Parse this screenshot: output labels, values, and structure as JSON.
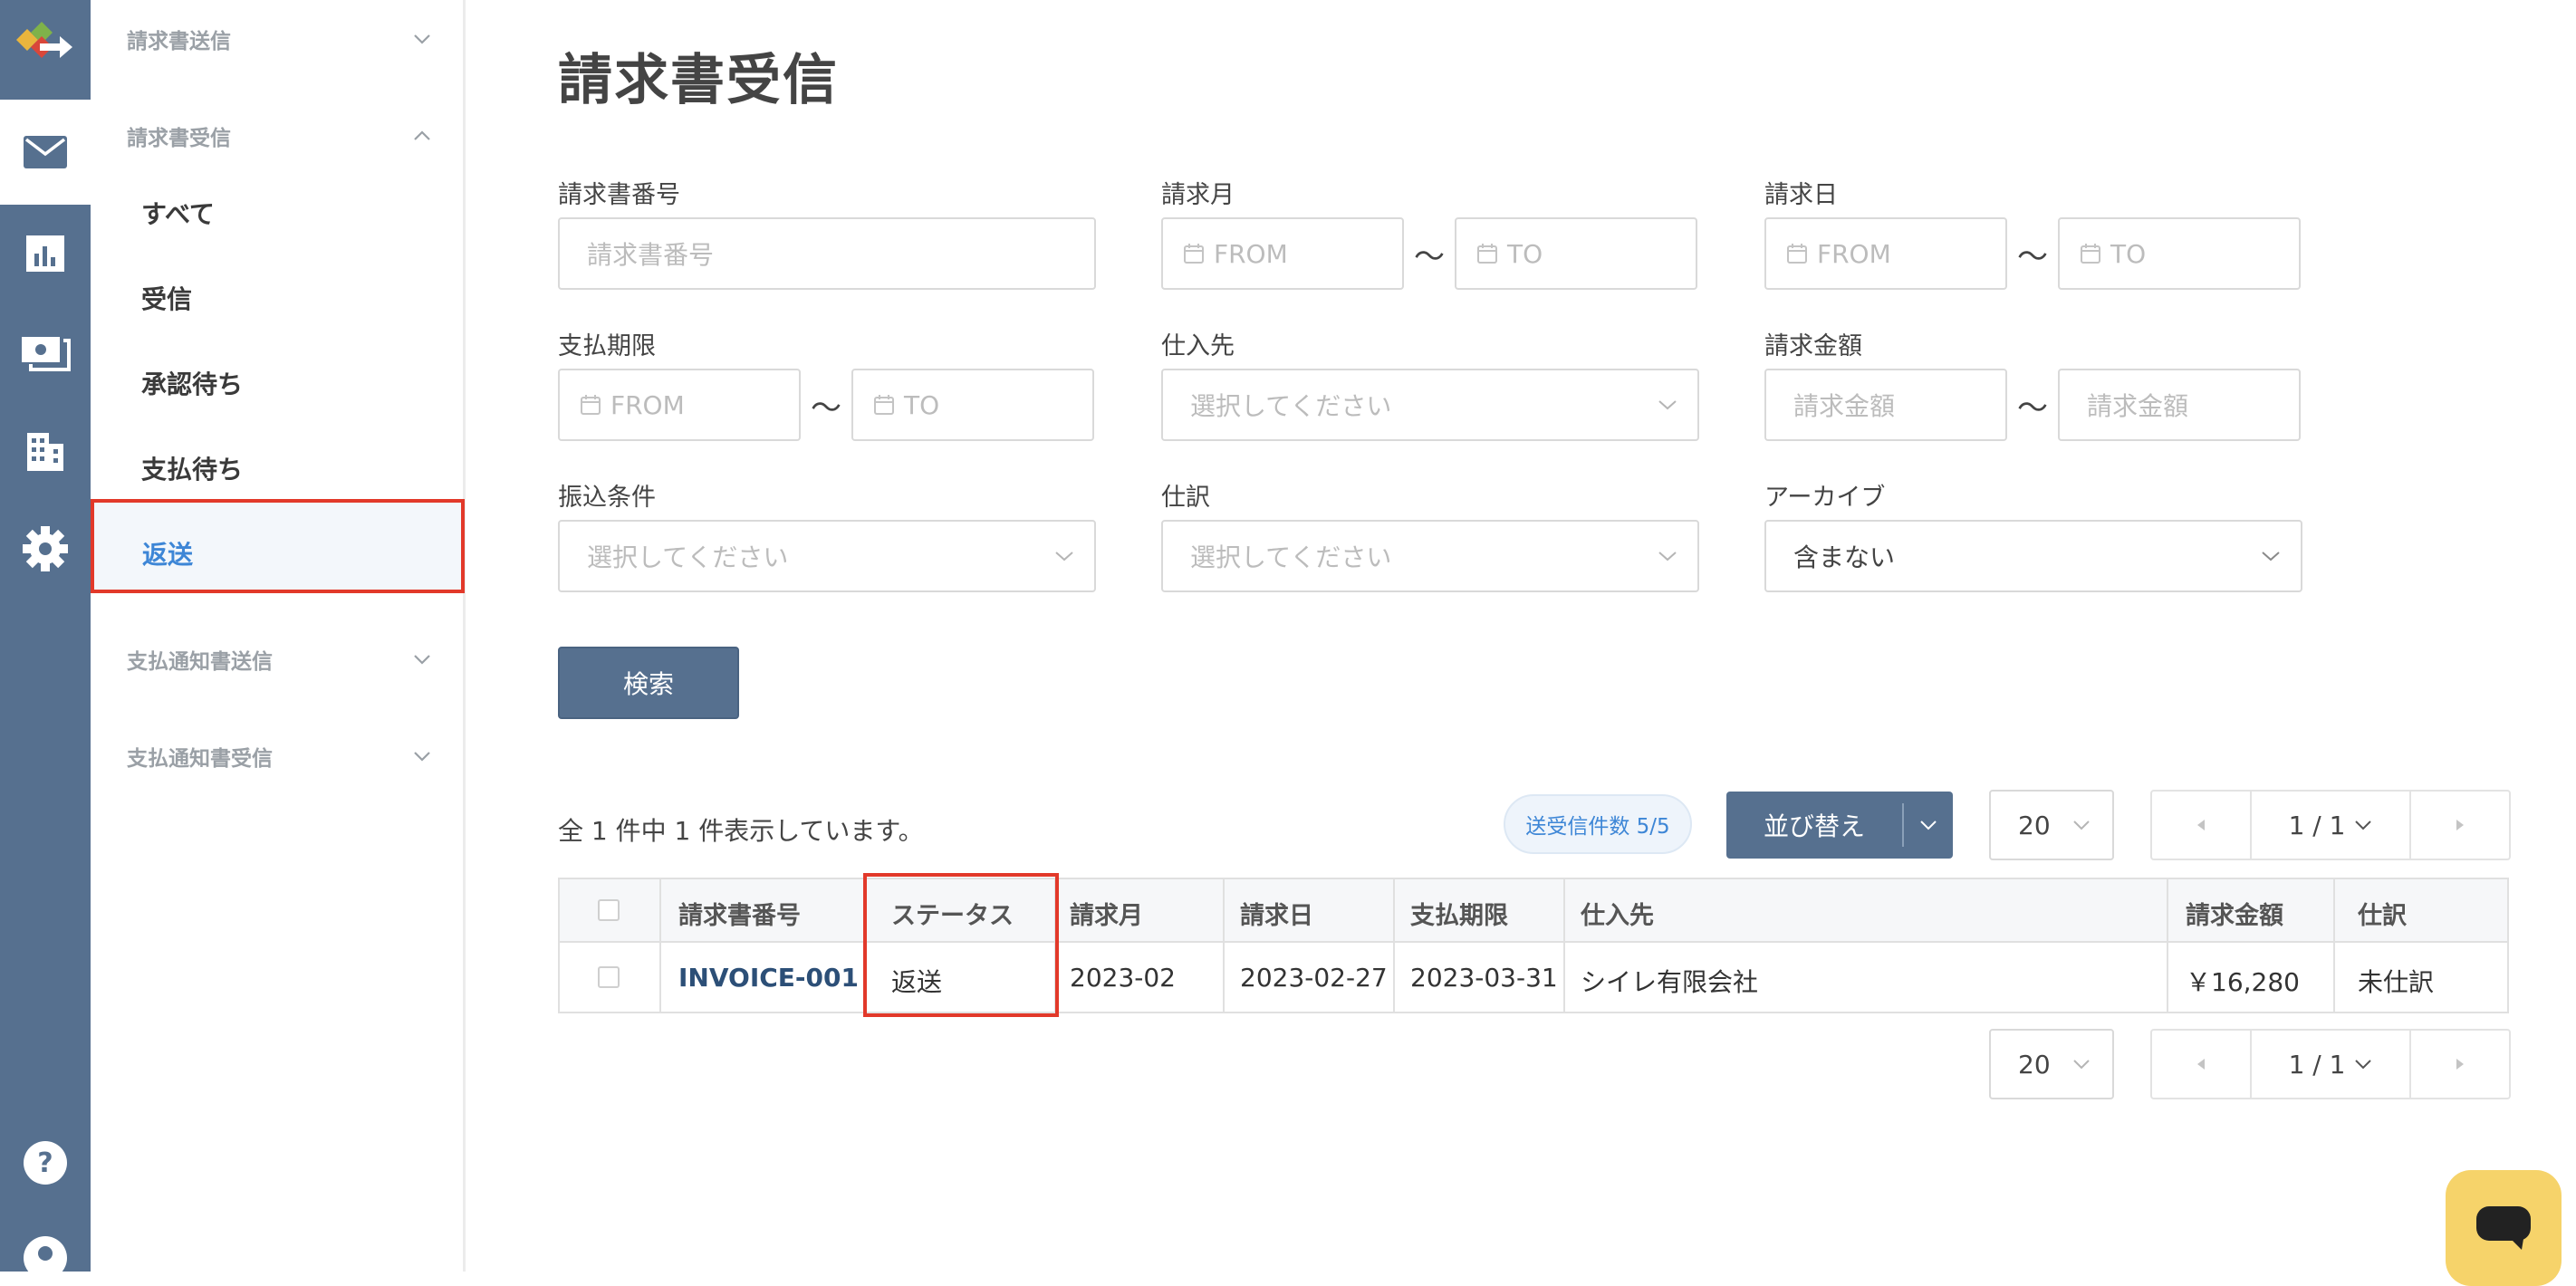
{
  "page_title": "請求書受信",
  "sidebar": {
    "groups": {
      "invoice_send": "請求書送信",
      "invoice_receive": "請求書受信",
      "notice_send": "支払通知書送信",
      "notice_receive": "支払通知書受信"
    },
    "items": [
      "すべて",
      "受信",
      "承認待ち",
      "支払待ち",
      "返送"
    ],
    "selected_item": "返送"
  },
  "filters": {
    "invoice_number": {
      "label": "請求書番号",
      "placeholder": "請求書番号"
    },
    "billing_month": {
      "label": "請求月",
      "from": "FROM",
      "to": "TO"
    },
    "billing_date": {
      "label": "請求日",
      "from": "FROM",
      "to": "TO"
    },
    "due_date": {
      "label": "支払期限",
      "from": "FROM",
      "to": "TO"
    },
    "supplier": {
      "label": "仕入先",
      "placeholder": "選択してください"
    },
    "amount": {
      "label": "請求金額",
      "from": "請求金額",
      "to": "請求金額"
    },
    "transfer": {
      "label": "振込条件",
      "placeholder": "選択してください"
    },
    "journal": {
      "label": "仕訳",
      "placeholder": "選択してください"
    },
    "archive": {
      "label": "アーカイブ",
      "value": "含まない"
    },
    "range_sep": "〜",
    "search_button": "検索"
  },
  "results": {
    "count_text": "全 1 件中 1 件表示しています。",
    "send_count_badge": "送受信件数 5/5",
    "sort_label": "並び替え",
    "page_size": "20",
    "page": "1 / 1"
  },
  "table": {
    "headers": [
      "請求書番号",
      "ステータス",
      "請求月",
      "請求日",
      "支払期限",
      "仕入先",
      "請求金額",
      "仕訳"
    ],
    "rows": [
      {
        "invoice_number": "INVOICE-001",
        "status": "返送",
        "month": "2023-02",
        "date": "2023-02-27",
        "due": "2023-03-31",
        "supplier": "シイレ有限会社",
        "amount": "￥16,280",
        "journal": "未仕訳"
      }
    ]
  },
  "colors": {
    "sidebar": "#56708f",
    "accent": "#3d86d6",
    "highlight": "#e2392a",
    "chat": "#f6d36a"
  }
}
